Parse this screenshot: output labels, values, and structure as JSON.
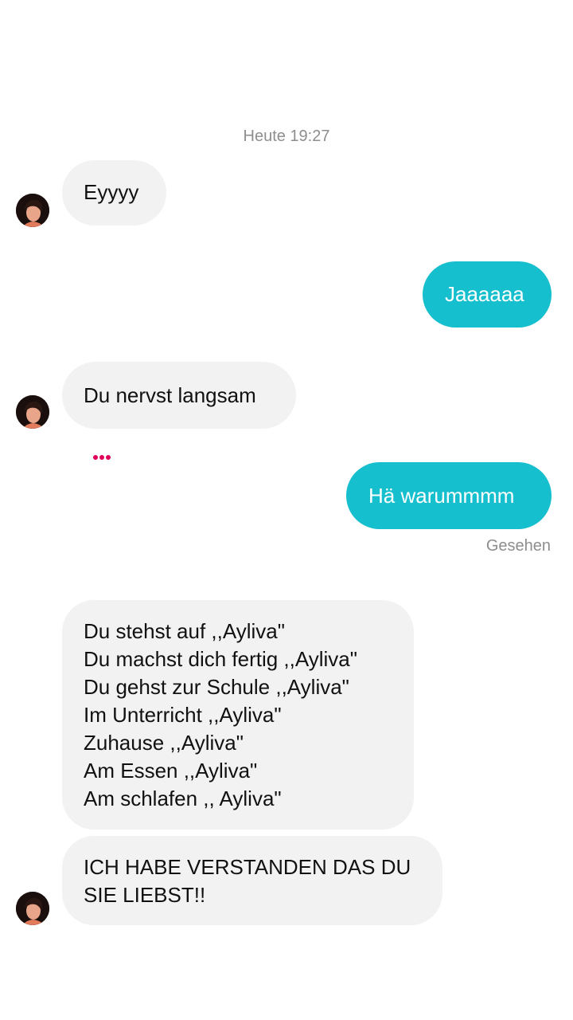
{
  "chat": {
    "timestamp": "Heute 19:27",
    "messages": [
      {
        "from": "them",
        "text": "Eyyyy"
      },
      {
        "from": "me",
        "text": "Jaaaaaa"
      },
      {
        "from": "them",
        "text": "Du nervst langsam"
      },
      {
        "from": "me",
        "text": "Hä warummmm"
      },
      {
        "from": "them",
        "lines": [
          "Du stehst auf ,,Ayliva\"",
          "Du machst dich fertig ,,Ayliva\"",
          "Du gehst zur Schule ,,Ayliva\"",
          "Im Unterricht ,,Ayliva\"",
          "Zuhause ,,Ayliva\"",
          "Am Essen ,,Ayliva\"",
          "Am schlafen ,, Ayliva\""
        ]
      },
      {
        "from": "them",
        "lines": [
          "ICH HABE VERSTANDEN DAS DU",
          "SIE LIEBST!!"
        ]
      }
    ],
    "seen_label": "Gesehen",
    "typing_indicator_color": "#e0005a",
    "outgoing_bubble_color": "#16bfce",
    "incoming_bubble_color": "#f2f2f2"
  }
}
